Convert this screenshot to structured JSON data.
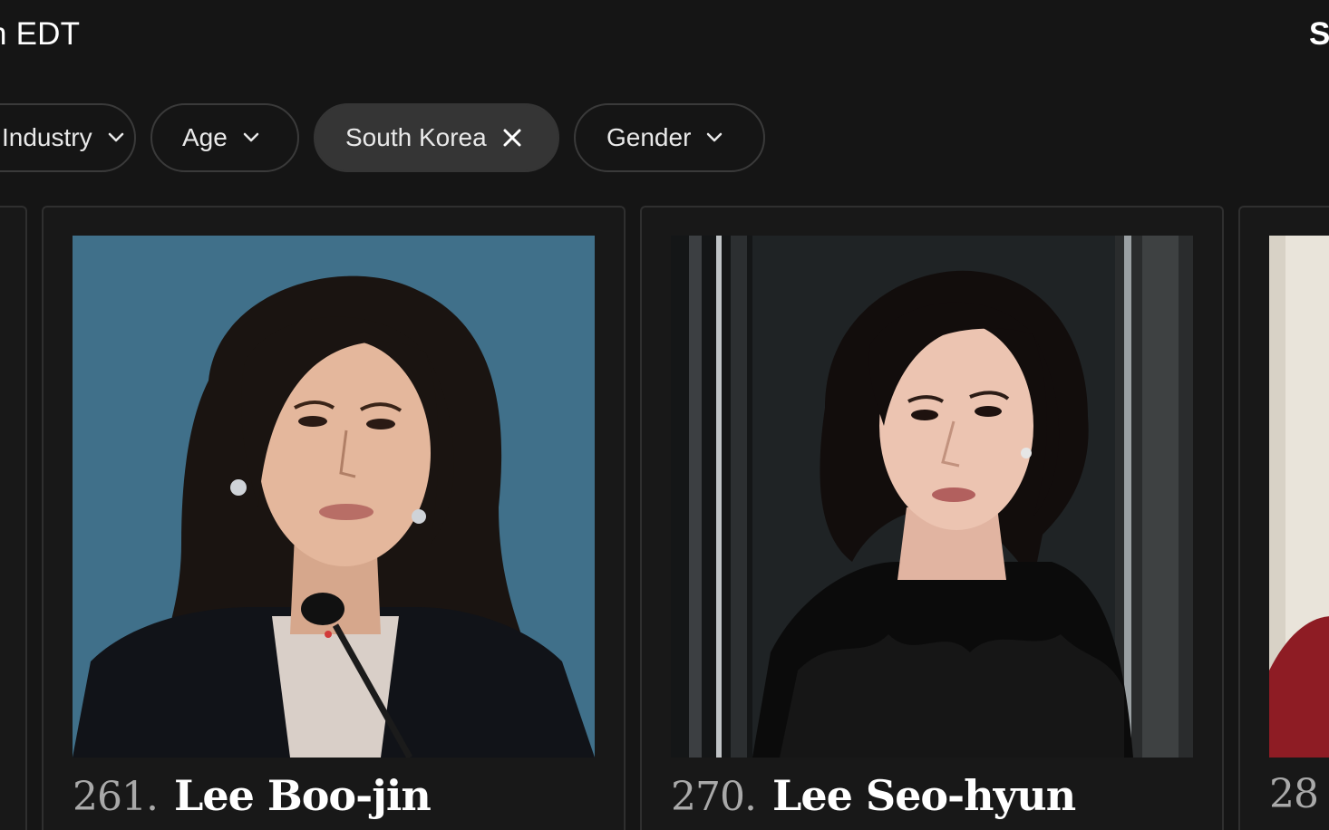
{
  "header": {
    "left_text": "n EDT",
    "right_text": "S"
  },
  "filters": [
    {
      "label": "Industry",
      "state": "collapsed"
    },
    {
      "label": "Age",
      "state": "collapsed"
    },
    {
      "label": "South Korea",
      "state": "selected"
    },
    {
      "label": "Gender",
      "state": "collapsed"
    }
  ],
  "cards": [
    {
      "rank": "261.",
      "name": "Lee Boo-jin"
    },
    {
      "rank": "270.",
      "name": "Lee Seo-hyun"
    },
    {
      "rank": "28",
      "name": ""
    }
  ],
  "colors": {
    "background": "#151515",
    "pill_border": "#3a3a3a",
    "pill_active": "#353535",
    "rank_text": "#a9a9a9"
  }
}
